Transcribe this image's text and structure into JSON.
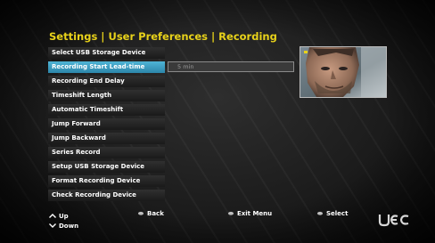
{
  "title": "Settings | User Preferences | Recording",
  "menu": {
    "items": [
      {
        "label": "Select USB Storage Device"
      },
      {
        "label": "Recording Start Lead-time"
      },
      {
        "label": "Recording End Delay"
      },
      {
        "label": "Timeshift Length"
      },
      {
        "label": "Automatic Timeshift"
      },
      {
        "label": "Jump Forward"
      },
      {
        "label": "Jump Backward"
      },
      {
        "label": "Series Record"
      },
      {
        "label": "Setup USB Storage Device"
      },
      {
        "label": "Format Recording Device"
      },
      {
        "label": "Check Recording Device"
      }
    ],
    "selected_index": 1
  },
  "value_field": {
    "value": "5 min"
  },
  "footer": {
    "up": "Up",
    "down": "Down",
    "back": "Back",
    "exit_menu": "Exit Menu",
    "select": "Select"
  },
  "colors": {
    "title": "#e8d21a",
    "selected": "#3a9fc4",
    "menu_bg": "#262626"
  },
  "icons": {
    "up": "chevron-up-icon",
    "down": "chevron-down-icon",
    "back": "remote-button-icon",
    "exit": "remote-button-icon",
    "select": "remote-button-icon",
    "brand": "uec-logo"
  },
  "logo_text": "UEC"
}
